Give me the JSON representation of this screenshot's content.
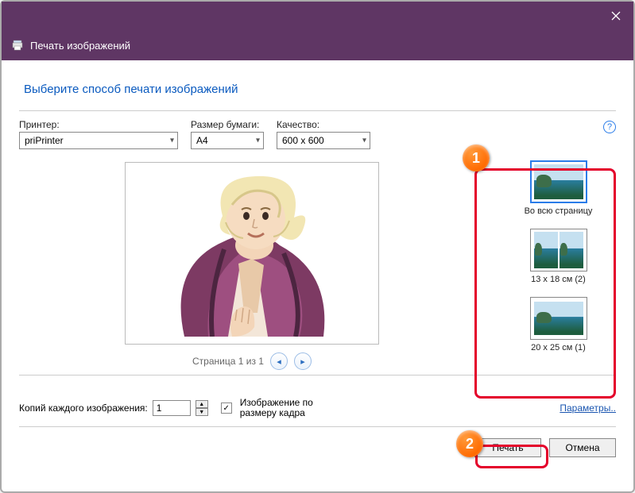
{
  "window": {
    "title": "Печать изображений"
  },
  "heading": "Выберите способ печати изображений",
  "controls": {
    "printer_label": "Принтер:",
    "printer_value": "priPrinter",
    "paper_label": "Размер бумаги:",
    "paper_value": "A4",
    "quality_label": "Качество:",
    "quality_value": "600 x 600"
  },
  "preview": {
    "page_counter": "Страница 1 из 1"
  },
  "layouts": [
    {
      "label": "Во всю страницу"
    },
    {
      "label": "13 x 18 см (2)"
    },
    {
      "label": "20 x 25 см (1)"
    }
  ],
  "bottom": {
    "copies_label": "Копий каждого изображения:",
    "copies_value": "1",
    "fit_label": "Изображение по размеру кадра",
    "params_link": "Параметры.."
  },
  "actions": {
    "print": "Печать",
    "cancel": "Отмена"
  },
  "annotations": {
    "badge1": "1",
    "badge2": "2"
  }
}
